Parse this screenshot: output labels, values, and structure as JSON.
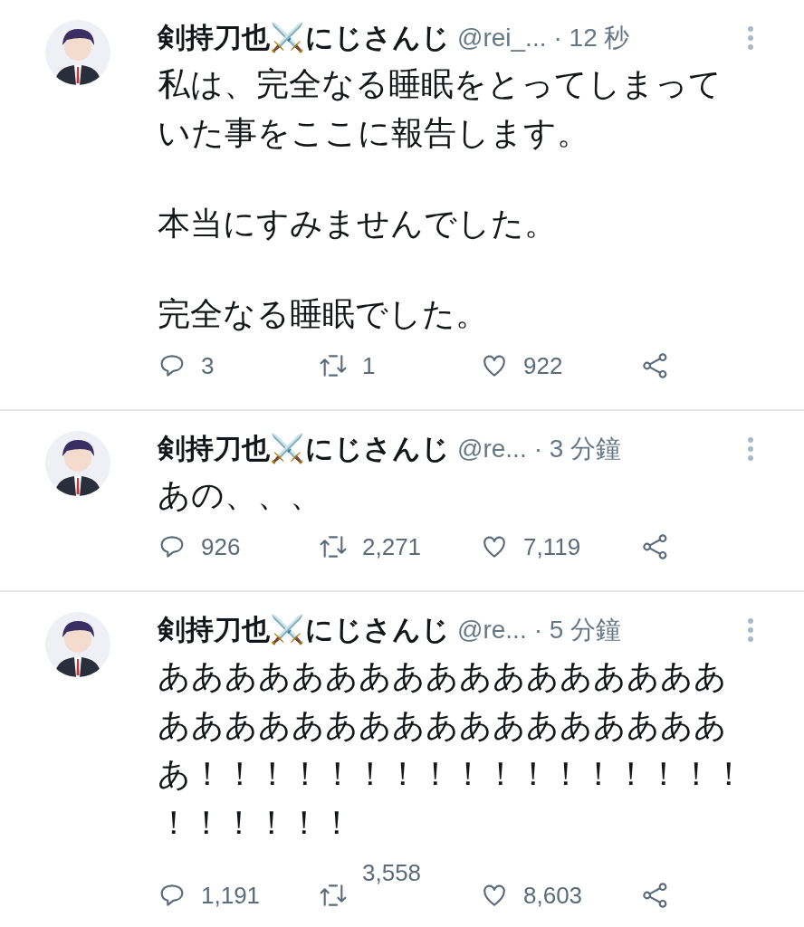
{
  "tweets": [
    {
      "name": "剣持刀也⚔️にじさんじ",
      "handle": "@rei_...",
      "time": "· 12 秒",
      "paragraphs": [
        "私は、完全なる睡眠をとってしまっていた事をここに報告します。",
        "本当にすみませんでした。",
        "完全なる睡眠でした。"
      ],
      "replies": "3",
      "retweets": "1",
      "retweets_raised": false,
      "likes": "922"
    },
    {
      "name": "剣持刀也⚔️にじさんじ",
      "handle": "@re...",
      "time": "· 3 分鐘",
      "paragraphs": [
        "あの、、、"
      ],
      "replies": "926",
      "retweets": "2,271",
      "retweets_raised": false,
      "likes": "7,119"
    },
    {
      "name": "剣持刀也⚔️にじさんじ",
      "handle": "@re...",
      "time": "· 5 分鐘",
      "paragraphs": [
        "あああああああああああああああああああああああああああああああああああ！！！！！！！！！！！！！！！！！！！！！！！"
      ],
      "replies": "1,191",
      "retweets": "3,558",
      "retweets_raised": true,
      "likes": "8,603"
    }
  ]
}
